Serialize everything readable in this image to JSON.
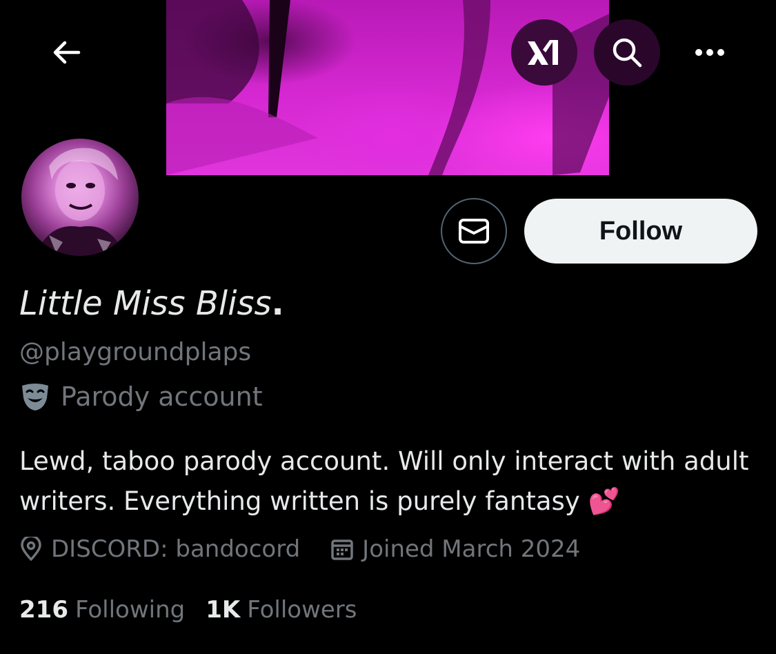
{
  "header": {
    "back_icon": "arrow-left-icon",
    "grok_icon": "xai-grok-icon",
    "search_icon": "search-icon",
    "more_icon": "more-dots-icon"
  },
  "profile": {
    "display_name": "Little Miss Bliss",
    "name_suffix": ".",
    "handle": "@playgroundplaps",
    "label_icon": "comedy-mask-icon",
    "label": "Parody account",
    "bio": "Lewd, taboo parody account. Will only interact with adult writers. Everything written is purely fantasy 💕",
    "location_icon": "location-pin-icon",
    "location": "DISCORD: bandocord",
    "joined_icon": "calendar-icon",
    "joined": "Joined March 2024",
    "following_count": "216",
    "following_label": "Following",
    "followers_count": "1K",
    "followers_label": "Followers"
  },
  "actions": {
    "message_icon": "envelope-icon",
    "follow_label": "Follow"
  },
  "colors": {
    "background": "#000000",
    "text_primary": "#e7e9ea",
    "text_secondary": "#71767b",
    "banner": "#d628d2",
    "follow_bg": "#eff3f4"
  }
}
